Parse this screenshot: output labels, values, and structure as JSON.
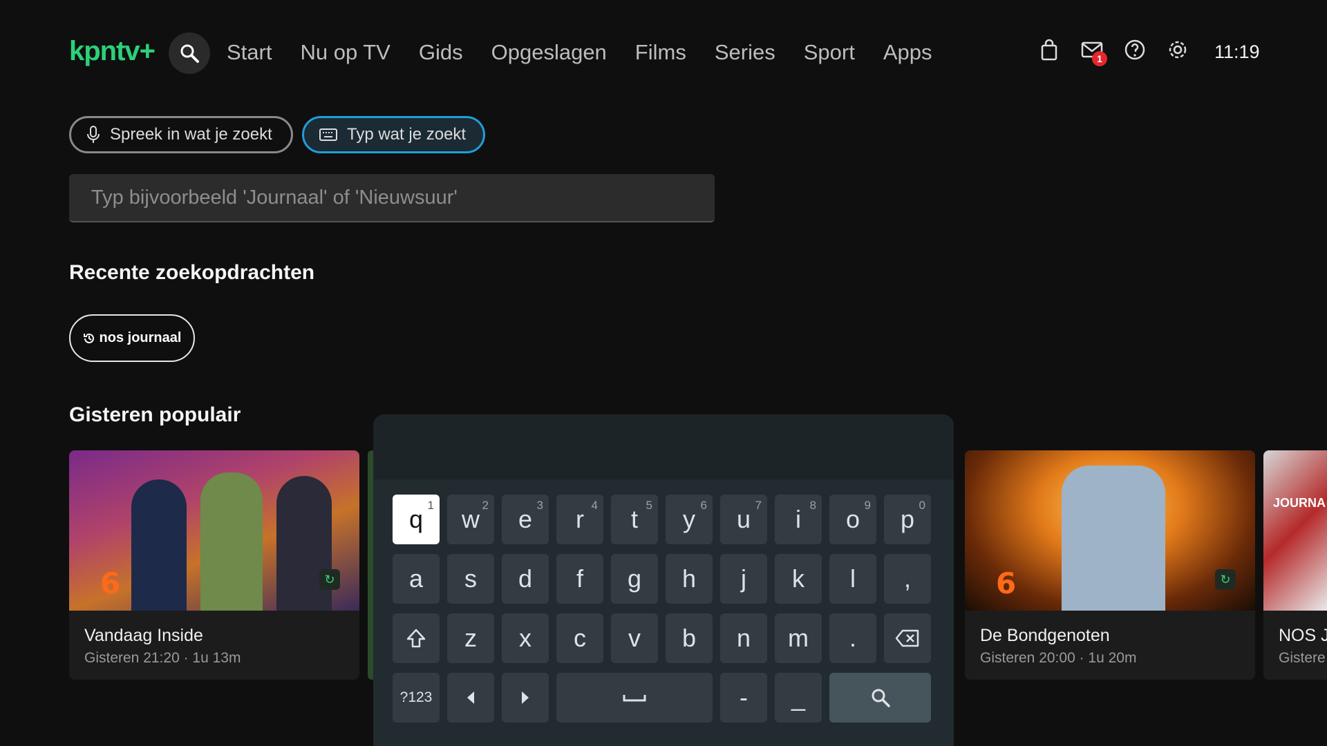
{
  "header": {
    "logo": "kpntv+",
    "nav": [
      "Start",
      "Nu op TV",
      "Gids",
      "Opgeslagen",
      "Films",
      "Series",
      "Sport",
      "Apps"
    ],
    "mail_badge": "1",
    "clock": "11:19",
    "icons": [
      "search-icon",
      "shopping-bag-icon",
      "mail-icon",
      "help-icon",
      "settings-icon"
    ]
  },
  "search": {
    "voice_label": "Spreek in wat je zoekt",
    "type_label": "Typ wat je zoekt",
    "placeholder": "Typ bijvoorbeeld 'Journaal' of 'Nieuwsuur'"
  },
  "recent": {
    "title": "Recente zoekopdrachten",
    "items": [
      "nos journaal"
    ]
  },
  "popular": {
    "title": "Gisteren populair",
    "cards": [
      {
        "title": "Vandaag Inside",
        "sub": "Gisteren 21:20 · 1u 13m",
        "channel": "6"
      },
      {
        "title": "De Bondgenoten",
        "sub": "Gisteren 20:00 · 1u 20m",
        "channel": "6"
      },
      {
        "title": "NOS Jo",
        "sub": "Gistere",
        "thumb_text": "JOURNA"
      }
    ]
  },
  "keyboard": {
    "row1": [
      {
        "k": "q",
        "n": "1"
      },
      {
        "k": "w",
        "n": "2"
      },
      {
        "k": "e",
        "n": "3"
      },
      {
        "k": "r",
        "n": "4"
      },
      {
        "k": "t",
        "n": "5"
      },
      {
        "k": "y",
        "n": "6"
      },
      {
        "k": "u",
        "n": "7"
      },
      {
        "k": "i",
        "n": "8"
      },
      {
        "k": "o",
        "n": "9"
      },
      {
        "k": "p",
        "n": "0"
      }
    ],
    "row2": [
      "a",
      "s",
      "d",
      "f",
      "g",
      "h",
      "j",
      "k",
      "l",
      ","
    ],
    "row3": [
      "z",
      "x",
      "c",
      "v",
      "b",
      "n",
      "m",
      "."
    ],
    "symbols_label": "?123",
    "dash": "-",
    "underscore": "_",
    "focused_key": "q"
  },
  "colors": {
    "accent_green": "#2bd17a",
    "focus_blue": "#1ea0d8",
    "badge_red": "#e5262e"
  }
}
